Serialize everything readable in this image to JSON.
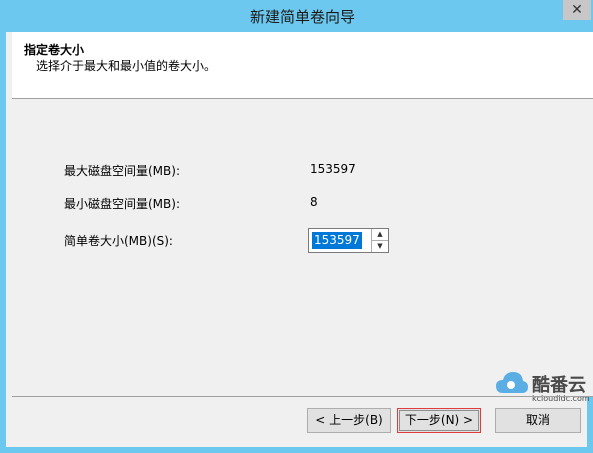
{
  "window": {
    "title": "新建简单卷向导",
    "close_label": "✕"
  },
  "header": {
    "title": "指定卷大小",
    "subtitle": "选择介于最大和最小值的卷大小。"
  },
  "fields": {
    "max_label": "最大磁盘空间量(MB):",
    "max_value": "153597",
    "min_label": "最小磁盘空间量(MB):",
    "min_value": "8",
    "size_label": "简单卷大小(MB)(S):",
    "size_value": "153597"
  },
  "buttons": {
    "prev": "< 上一步(B)",
    "next": "下一步(N) >",
    "cancel": "取消"
  },
  "watermark": {
    "brand": "酷番云",
    "url": "kcloudidc.com"
  },
  "colors": {
    "titlebar": "#6cc8ee",
    "selection": "#0078d7",
    "highlight_border": "#e23d3d"
  },
  "icons": {
    "close": "close-icon",
    "spin_up": "chevron-up-icon",
    "spin_down": "chevron-down-icon",
    "cloud": "cloud-icon"
  }
}
